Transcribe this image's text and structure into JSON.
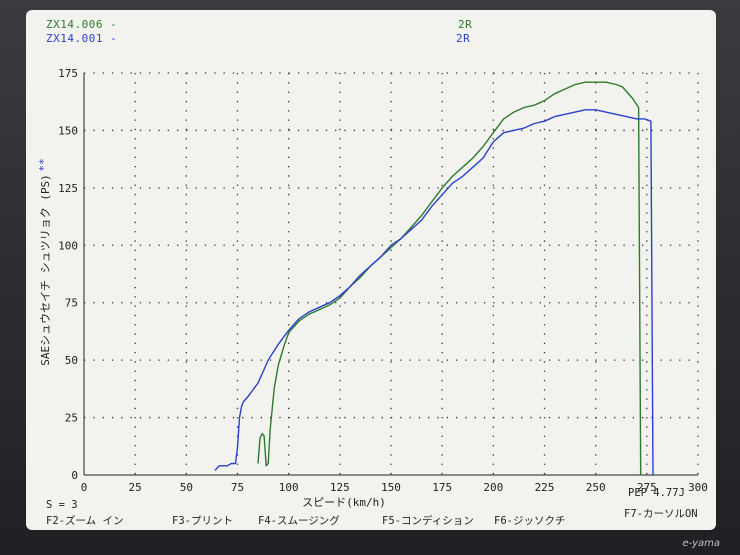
{
  "legend": {
    "run1_name": "ZX14.006 -",
    "run1_tag": "2R",
    "run2_name": "ZX14.001 -",
    "run2_tag": "2R"
  },
  "marker": "**",
  "footer": {
    "s_value": "S = 3",
    "pep": "PEP  4.77J",
    "f2": "F2-ズーム イン",
    "f3": "F3-プリント",
    "f4": "F4-スムージング",
    "f5": "F5-コンディション",
    "f6": "F6-ジッソクチ",
    "f7": "F7-カーソルON"
  },
  "brand": "e-yama",
  "colors": {
    "run1": "#2e7a2e",
    "run2": "#2b3fd0"
  },
  "chart_data": {
    "type": "line",
    "xlabel": "スピード(km/h)",
    "ylabel": "SAEシュウセイチ シュツリョク (PS)",
    "xlim": [
      0,
      300
    ],
    "ylim": [
      0,
      175
    ],
    "xticks": [
      0,
      25,
      50,
      75,
      100,
      125,
      150,
      175,
      200,
      225,
      250,
      275,
      300
    ],
    "yticks": [
      0,
      25,
      50,
      75,
      100,
      125,
      150,
      175
    ],
    "grid": true,
    "series": [
      {
        "name": "ZX14.006",
        "x": [
          85,
          86,
          87,
          88,
          89,
          90,
          91,
          93,
          95,
          98,
          100,
          105,
          110,
          115,
          120,
          125,
          130,
          135,
          140,
          145,
          150,
          155,
          160,
          165,
          170,
          175,
          180,
          185,
          190,
          195,
          200,
          205,
          210,
          215,
          220,
          225,
          230,
          235,
          240,
          245,
          250,
          255,
          260,
          263,
          265,
          268,
          271,
          272
        ],
        "y": [
          5,
          16,
          18,
          17,
          4,
          5,
          20,
          38,
          48,
          57,
          62,
          67,
          70,
          72,
          74,
          77,
          82,
          86,
          91,
          95,
          99,
          103,
          108,
          113,
          119,
          125,
          130,
          134,
          138,
          143,
          149,
          155,
          158,
          160,
          161,
          163,
          166,
          168,
          170,
          171,
          171,
          171,
          170,
          169,
          167,
          164,
          160,
          0
        ]
      },
      {
        "name": "ZX14.001",
        "x": [
          64,
          66,
          68,
          70,
          72,
          74,
          75,
          76,
          77,
          78,
          80,
          85,
          90,
          95,
          100,
          105,
          110,
          115,
          120,
          125,
          130,
          135,
          140,
          145,
          150,
          155,
          160,
          165,
          170,
          175,
          180,
          185,
          190,
          195,
          200,
          205,
          210,
          215,
          220,
          225,
          230,
          235,
          240,
          245,
          250,
          255,
          260,
          265,
          270,
          274,
          277,
          278
        ],
        "y": [
          2,
          4,
          4,
          4,
          5,
          5,
          12,
          25,
          30,
          32,
          34,
          40,
          50,
          57,
          63,
          68,
          71,
          73,
          75,
          78,
          82,
          87,
          91,
          95,
          100,
          103,
          107,
          111,
          117,
          122,
          127,
          130,
          134,
          138,
          145,
          149,
          150,
          151,
          153,
          154,
          156,
          157,
          158,
          159,
          159,
          158,
          157,
          156,
          155,
          155,
          154,
          0
        ]
      }
    ]
  }
}
